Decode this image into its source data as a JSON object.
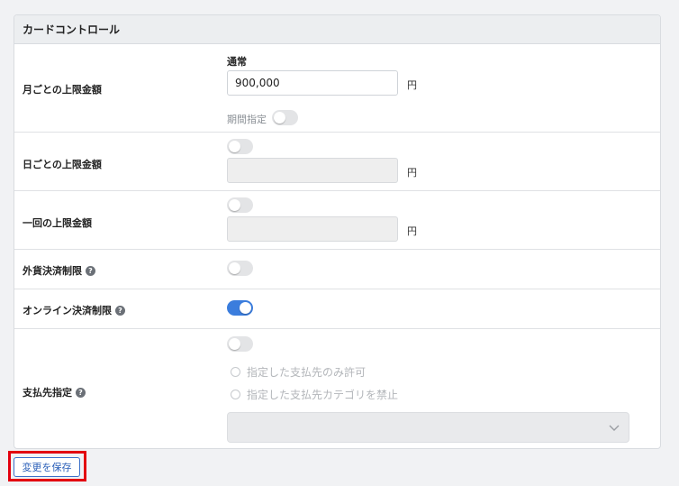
{
  "card": {
    "title": "カードコントロール",
    "rows": {
      "monthly": {
        "label": "月ごとの上限金額",
        "mode_label": "通常",
        "value": "900,000",
        "unit": "円",
        "period_label": "期間指定",
        "period_enabled": false
      },
      "daily": {
        "label": "日ごとの上限金額",
        "enabled": false,
        "value": "",
        "unit": "円"
      },
      "per_transaction": {
        "label": "一回の上限金額",
        "enabled": false,
        "value": "",
        "unit": "円"
      },
      "foreign_currency": {
        "label": "外貨決済制限",
        "enabled": false
      },
      "online": {
        "label": "オンライン決済制限",
        "enabled": true
      },
      "payee": {
        "label": "支払先指定",
        "enabled": false,
        "options": [
          "指定した支払先のみ許可",
          "指定した支払先カテゴリを禁止"
        ],
        "select_value": ""
      }
    }
  },
  "save_label": "変更を保存",
  "colors": {
    "toggle_on": "#3b7ddd",
    "toggle_off": "#e3e4e6",
    "highlight": "#e3000f",
    "button_text": "#2b5fb8"
  }
}
